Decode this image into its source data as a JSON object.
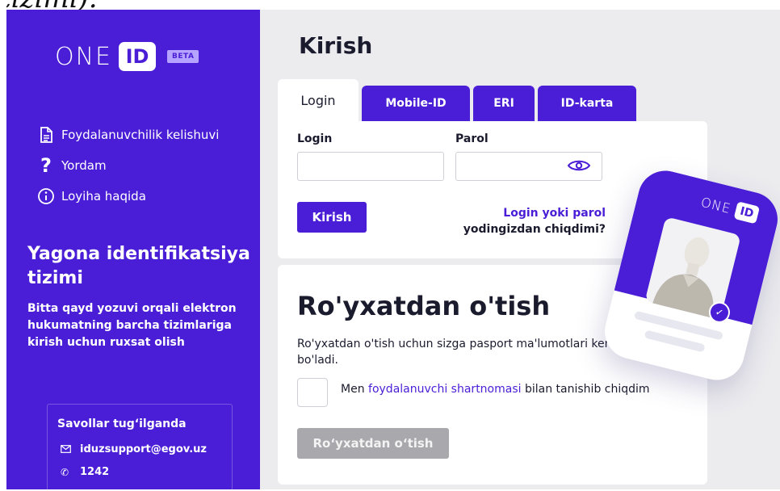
{
  "top_text": "tizimi).",
  "sidebar": {
    "logo": {
      "one": "ONE",
      "id": "ID",
      "beta": "BETA"
    },
    "nav": [
      {
        "label": "Foydalanuvchilik kelishuvi",
        "icon": "document-icon"
      },
      {
        "label": "Yordam",
        "icon": "question-icon"
      },
      {
        "label": "Loyiha haqida",
        "icon": "info-icon"
      }
    ],
    "title": "Yagona identifikatsiya tizimi",
    "description": "Bitta qayd yozuvi orqali elektron hukumatning barcha tizimlariga kirish uchun ruxsat olish",
    "support": {
      "title": "Savollar tug‘ilganda",
      "email": "iduzsupport@egov.uz",
      "phone": "1242"
    }
  },
  "main": {
    "title": "Kirish",
    "tabs": [
      {
        "label": "Login",
        "active": true
      },
      {
        "label": "Mobile-ID",
        "active": false
      },
      {
        "label": "ERI",
        "active": false
      },
      {
        "label": "ID-karta",
        "active": false
      }
    ],
    "login_form": {
      "login_label": "Login",
      "login_value": "",
      "password_label": "Parol",
      "password_value": "",
      "submit_label": "Kirish",
      "forgot_line1": "Login yoki parol",
      "forgot_line2": "yodingizdan chiqdimi?"
    },
    "register": {
      "title": "Ro'yxatdan o'tish",
      "description": "Ro'yxatdan o'tish uchun sizga pasport ma'lumotlari kerak bo'ladi.",
      "agree_prefix": "Men",
      "agree_link": "foydalanuvchi shartnomasi",
      "agree_suffix": "bilan tanishib chiqdim",
      "button_label": "Ro‘yxatdan o‘tish"
    }
  },
  "id_card": {
    "one": "ONE",
    "id": "ID"
  },
  "colors": {
    "brand": "#4a1ed6",
    "background": "#ececef",
    "disabled": "#a9a9ad"
  }
}
